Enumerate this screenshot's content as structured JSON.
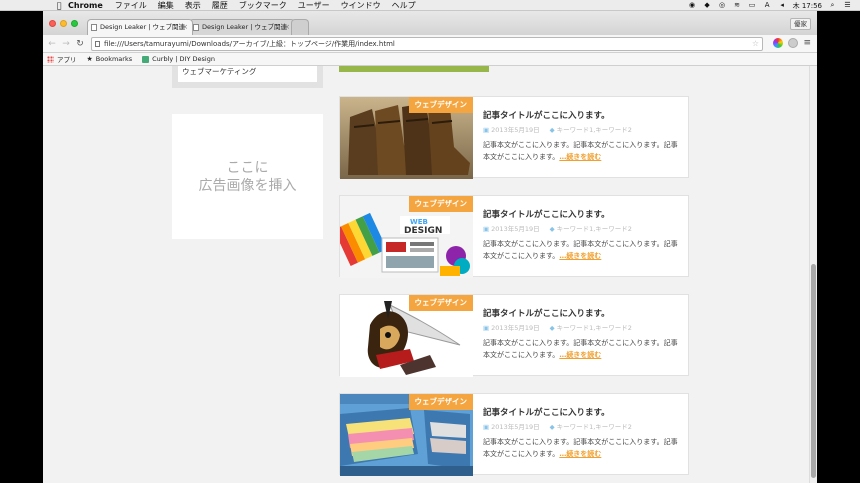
{
  "menubar": {
    "app_name": "Chrome",
    "items": [
      "ファイル",
      "編集",
      "表示",
      "履歴",
      "ブックマーク",
      "ユーザー",
      "ウインドウ",
      "ヘルプ"
    ],
    "clock": "木 17:56",
    "input_mode": "A"
  },
  "browser": {
    "tabs": [
      {
        "label": "Design Leaker | ウェブ関連"
      },
      {
        "label": "Design Leaker | ウェブ関連"
      }
    ],
    "guest_label": "優家",
    "url": "file:///Users/tamurayumi/Downloads/アーカイブ/上級：トップページ/作業用/index.html",
    "bookmarks": [
      "アプリ",
      "Bookmarks",
      "Curbly | DIY Design"
    ]
  },
  "sidebar": {
    "menu_item": "ウェブマーケティング",
    "ad_line1": "ここに",
    "ad_line2": "広告画像を挿入"
  },
  "articles": [
    {
      "badge": "ウェブデザイン",
      "title": "記事タイトルがここに入ります。",
      "date": "2013年5月19日",
      "keywords": "キーワード1,キーワード2",
      "excerpt": "記事本文がここに入ります。記事本文がここに入ります。記事本文がここに入ります。",
      "readmore": "…続きを読む",
      "image": "boots"
    },
    {
      "badge": "ウェブデザイン",
      "title": "記事タイトルがここに入ります。",
      "date": "2013年5月19日",
      "keywords": "キーワード1,キーワード2",
      "excerpt": "記事本文がここに入ります。記事本文がここに入ります。記事本文がここに入ります。",
      "readmore": "…続きを読む",
      "image": "web-design"
    },
    {
      "badge": "ウェブデザイン",
      "title": "記事タイトルがここに入ります。",
      "date": "2013年5月19日",
      "keywords": "キーワード1,キーワード2",
      "excerpt": "記事本文がここに入ります。記事本文がここに入ります。記事本文がここに入ります。",
      "readmore": "…続きを読む",
      "image": "samurai"
    },
    {
      "badge": "ウェブデザイン",
      "title": "記事タイトルがここに入ります。",
      "date": "2013年5月19日",
      "keywords": "キーワード1,キーワード2",
      "excerpt": "記事本文がここに入ります。記事本文がここに入ります。記事本文がここに入ります。",
      "readmore": "…続きを読む",
      "image": "file-drawers"
    }
  ],
  "colors": {
    "badge": "#f5a53f",
    "readmore": "#f0a030",
    "accent_strip": "#98b74a"
  }
}
